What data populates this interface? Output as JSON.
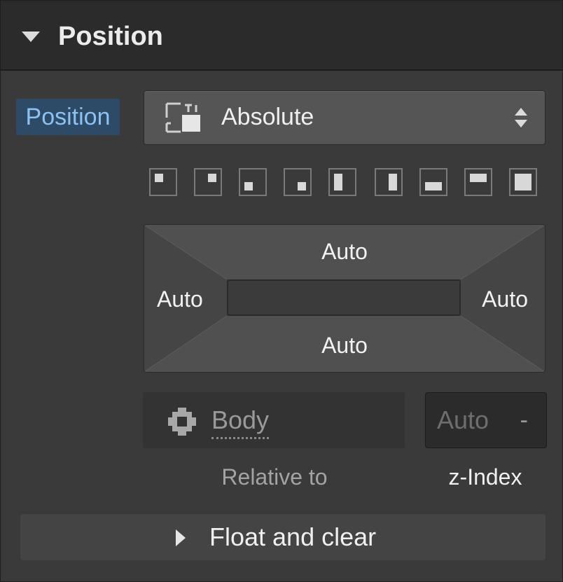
{
  "section": {
    "title": "Position",
    "collapse_icon": "caret-down-icon"
  },
  "position_field": {
    "label": "Position",
    "value": "Absolute",
    "icon": "absolute-position-icon",
    "arrows_icon": "select-updown-icon"
  },
  "presets": [
    "top-left",
    "top-right",
    "bottom-left",
    "bottom-right",
    "left",
    "right",
    "bottom",
    "top",
    "full"
  ],
  "offsets": {
    "top": "Auto",
    "right": "Auto",
    "bottom": "Auto",
    "left": "Auto"
  },
  "relative_to": {
    "value": "Body",
    "caption": "Relative to",
    "icon": "gear-icon"
  },
  "z_index": {
    "value": "Auto",
    "dash": "-",
    "caption": "z-Index"
  },
  "float_clear": {
    "label": "Float and clear",
    "icon": "caret-right-icon"
  },
  "colors": {
    "panel_bg": "#3a3a3a",
    "header_bg": "#2b2b2b",
    "label_highlight_bg": "#2d4a66",
    "label_highlight_text": "#8cc2f2"
  }
}
